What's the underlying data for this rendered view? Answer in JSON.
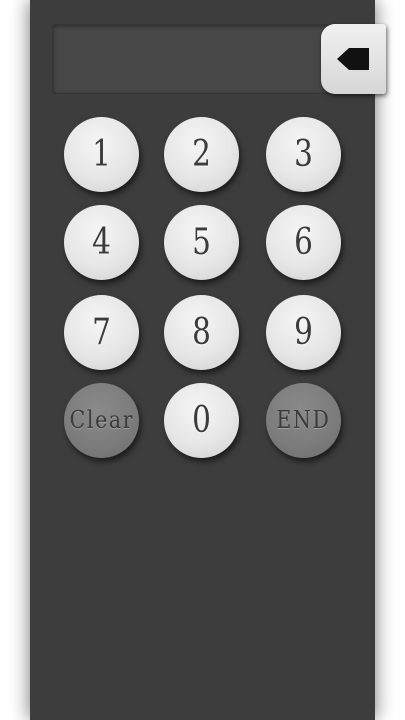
{
  "display": {
    "value": ""
  },
  "backspace": {
    "icon": "backspace-icon"
  },
  "keypad": {
    "k1": "1",
    "k2": "2",
    "k3": "3",
    "k4": "4",
    "k5": "5",
    "k6": "6",
    "k7": "7",
    "k8": "8",
    "k9": "9",
    "k0": "0",
    "clear": "Clear",
    "end": "END"
  },
  "colors": {
    "panel": "#3d3d3d",
    "key_light": "#e6e6e6",
    "key_dark": "#7b7b7b"
  }
}
